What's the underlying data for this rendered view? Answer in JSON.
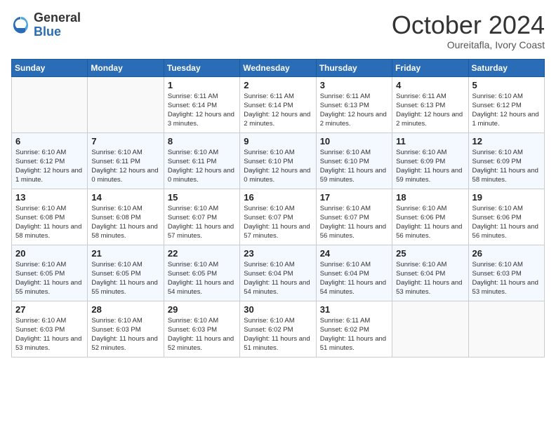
{
  "logo": {
    "general": "General",
    "blue": "Blue"
  },
  "title": "October 2024",
  "location": "Oureitafla, Ivory Coast",
  "days_header": [
    "Sunday",
    "Monday",
    "Tuesday",
    "Wednesday",
    "Thursday",
    "Friday",
    "Saturday"
  ],
  "weeks": [
    [
      {
        "day": "",
        "sunrise": "",
        "sunset": "",
        "daylight": ""
      },
      {
        "day": "",
        "sunrise": "",
        "sunset": "",
        "daylight": ""
      },
      {
        "day": "1",
        "sunrise": "Sunrise: 6:11 AM",
        "sunset": "Sunset: 6:14 PM",
        "daylight": "Daylight: 12 hours and 3 minutes."
      },
      {
        "day": "2",
        "sunrise": "Sunrise: 6:11 AM",
        "sunset": "Sunset: 6:14 PM",
        "daylight": "Daylight: 12 hours and 2 minutes."
      },
      {
        "day": "3",
        "sunrise": "Sunrise: 6:11 AM",
        "sunset": "Sunset: 6:13 PM",
        "daylight": "Daylight: 12 hours and 2 minutes."
      },
      {
        "day": "4",
        "sunrise": "Sunrise: 6:11 AM",
        "sunset": "Sunset: 6:13 PM",
        "daylight": "Daylight: 12 hours and 2 minutes."
      },
      {
        "day": "5",
        "sunrise": "Sunrise: 6:10 AM",
        "sunset": "Sunset: 6:12 PM",
        "daylight": "Daylight: 12 hours and 1 minute."
      }
    ],
    [
      {
        "day": "6",
        "sunrise": "Sunrise: 6:10 AM",
        "sunset": "Sunset: 6:12 PM",
        "daylight": "Daylight: 12 hours and 1 minute."
      },
      {
        "day": "7",
        "sunrise": "Sunrise: 6:10 AM",
        "sunset": "Sunset: 6:11 PM",
        "daylight": "Daylight: 12 hours and 0 minutes."
      },
      {
        "day": "8",
        "sunrise": "Sunrise: 6:10 AM",
        "sunset": "Sunset: 6:11 PM",
        "daylight": "Daylight: 12 hours and 0 minutes."
      },
      {
        "day": "9",
        "sunrise": "Sunrise: 6:10 AM",
        "sunset": "Sunset: 6:10 PM",
        "daylight": "Daylight: 12 hours and 0 minutes."
      },
      {
        "day": "10",
        "sunrise": "Sunrise: 6:10 AM",
        "sunset": "Sunset: 6:10 PM",
        "daylight": "Daylight: 11 hours and 59 minutes."
      },
      {
        "day": "11",
        "sunrise": "Sunrise: 6:10 AM",
        "sunset": "Sunset: 6:09 PM",
        "daylight": "Daylight: 11 hours and 59 minutes."
      },
      {
        "day": "12",
        "sunrise": "Sunrise: 6:10 AM",
        "sunset": "Sunset: 6:09 PM",
        "daylight": "Daylight: 11 hours and 58 minutes."
      }
    ],
    [
      {
        "day": "13",
        "sunrise": "Sunrise: 6:10 AM",
        "sunset": "Sunset: 6:08 PM",
        "daylight": "Daylight: 11 hours and 58 minutes."
      },
      {
        "day": "14",
        "sunrise": "Sunrise: 6:10 AM",
        "sunset": "Sunset: 6:08 PM",
        "daylight": "Daylight: 11 hours and 58 minutes."
      },
      {
        "day": "15",
        "sunrise": "Sunrise: 6:10 AM",
        "sunset": "Sunset: 6:07 PM",
        "daylight": "Daylight: 11 hours and 57 minutes."
      },
      {
        "day": "16",
        "sunrise": "Sunrise: 6:10 AM",
        "sunset": "Sunset: 6:07 PM",
        "daylight": "Daylight: 11 hours and 57 minutes."
      },
      {
        "day": "17",
        "sunrise": "Sunrise: 6:10 AM",
        "sunset": "Sunset: 6:07 PM",
        "daylight": "Daylight: 11 hours and 56 minutes."
      },
      {
        "day": "18",
        "sunrise": "Sunrise: 6:10 AM",
        "sunset": "Sunset: 6:06 PM",
        "daylight": "Daylight: 11 hours and 56 minutes."
      },
      {
        "day": "19",
        "sunrise": "Sunrise: 6:10 AM",
        "sunset": "Sunset: 6:06 PM",
        "daylight": "Daylight: 11 hours and 56 minutes."
      }
    ],
    [
      {
        "day": "20",
        "sunrise": "Sunrise: 6:10 AM",
        "sunset": "Sunset: 6:05 PM",
        "daylight": "Daylight: 11 hours and 55 minutes."
      },
      {
        "day": "21",
        "sunrise": "Sunrise: 6:10 AM",
        "sunset": "Sunset: 6:05 PM",
        "daylight": "Daylight: 11 hours and 55 minutes."
      },
      {
        "day": "22",
        "sunrise": "Sunrise: 6:10 AM",
        "sunset": "Sunset: 6:05 PM",
        "daylight": "Daylight: 11 hours and 54 minutes."
      },
      {
        "day": "23",
        "sunrise": "Sunrise: 6:10 AM",
        "sunset": "Sunset: 6:04 PM",
        "daylight": "Daylight: 11 hours and 54 minutes."
      },
      {
        "day": "24",
        "sunrise": "Sunrise: 6:10 AM",
        "sunset": "Sunset: 6:04 PM",
        "daylight": "Daylight: 11 hours and 54 minutes."
      },
      {
        "day": "25",
        "sunrise": "Sunrise: 6:10 AM",
        "sunset": "Sunset: 6:04 PM",
        "daylight": "Daylight: 11 hours and 53 minutes."
      },
      {
        "day": "26",
        "sunrise": "Sunrise: 6:10 AM",
        "sunset": "Sunset: 6:03 PM",
        "daylight": "Daylight: 11 hours and 53 minutes."
      }
    ],
    [
      {
        "day": "27",
        "sunrise": "Sunrise: 6:10 AM",
        "sunset": "Sunset: 6:03 PM",
        "daylight": "Daylight: 11 hours and 53 minutes."
      },
      {
        "day": "28",
        "sunrise": "Sunrise: 6:10 AM",
        "sunset": "Sunset: 6:03 PM",
        "daylight": "Daylight: 11 hours and 52 minutes."
      },
      {
        "day": "29",
        "sunrise": "Sunrise: 6:10 AM",
        "sunset": "Sunset: 6:03 PM",
        "daylight": "Daylight: 11 hours and 52 minutes."
      },
      {
        "day": "30",
        "sunrise": "Sunrise: 6:10 AM",
        "sunset": "Sunset: 6:02 PM",
        "daylight": "Daylight: 11 hours and 51 minutes."
      },
      {
        "day": "31",
        "sunrise": "Sunrise: 6:11 AM",
        "sunset": "Sunset: 6:02 PM",
        "daylight": "Daylight: 11 hours and 51 minutes."
      },
      {
        "day": "",
        "sunrise": "",
        "sunset": "",
        "daylight": ""
      },
      {
        "day": "",
        "sunrise": "",
        "sunset": "",
        "daylight": ""
      }
    ]
  ]
}
